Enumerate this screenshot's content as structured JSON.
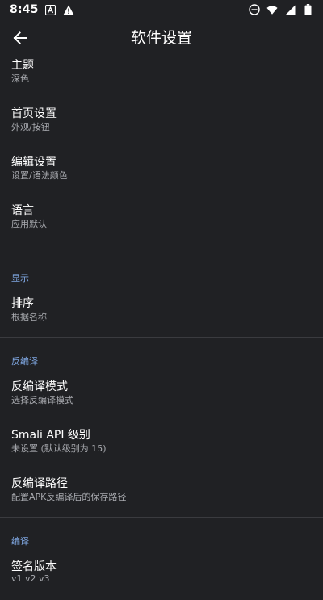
{
  "status_bar": {
    "time": "8:45",
    "left_icons": [
      "a-icon",
      "warning-icon"
    ],
    "right_icons": [
      "do-not-disturb-icon",
      "wifi-icon",
      "signal-icon",
      "battery-icon"
    ]
  },
  "app_bar": {
    "title": "软件设置",
    "back_icon": "arrow-left-icon"
  },
  "sections": [
    {
      "header": "",
      "items": [
        {
          "title": "主题",
          "subtitle": "深色"
        },
        {
          "title": "首页设置",
          "subtitle": "外观/按钮"
        },
        {
          "title": "编辑设置",
          "subtitle": "设置/语法颜色"
        },
        {
          "title": "语言",
          "subtitle": "应用默认"
        }
      ]
    },
    {
      "header": "显示",
      "items": [
        {
          "title": "排序",
          "subtitle": "根据名称"
        }
      ]
    },
    {
      "header": "反编译",
      "items": [
        {
          "title": "反编译模式",
          "subtitle": "选择反编译模式"
        },
        {
          "title": "Smali API 级别",
          "subtitle": "未设置 (默认级别为 15)"
        },
        {
          "title": "反编译路径",
          "subtitle": "配置APK反编译后的保存路径"
        }
      ]
    },
    {
      "header": "编译",
      "items": [
        {
          "title": "签名版本",
          "subtitle": "v1 v2 v3"
        }
      ]
    }
  ],
  "colors": {
    "background": "#202124",
    "divider": "#3a3b3f",
    "section_header": "#7ea6e0",
    "subtitle": "#a9abb0"
  }
}
